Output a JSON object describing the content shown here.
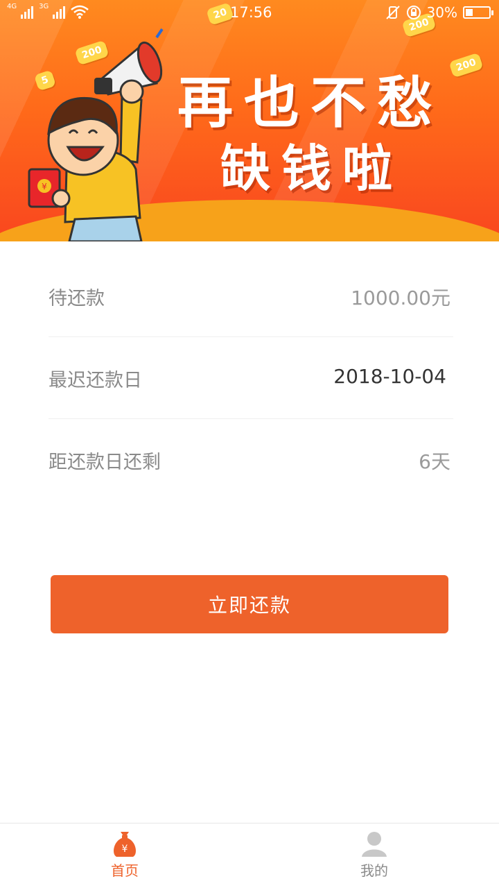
{
  "status_bar": {
    "network_1": "4G",
    "network_2": "3G",
    "time": "17:56",
    "battery_text": "30%",
    "battery_level": 0.3
  },
  "banner": {
    "title_line1": "再也不愁",
    "title_line2": "缺钱啦",
    "chips": [
      "200",
      "200",
      "200",
      "5",
      "20"
    ],
    "colors": {
      "top": "#ff8a1f",
      "bottom": "#f9461f"
    }
  },
  "repayment": {
    "rows": [
      {
        "label": "待还款",
        "value": "1000.00元"
      },
      {
        "label": "最迟还款日",
        "value": "2018-10-04"
      },
      {
        "label": "距还款日还剩",
        "value": "6天"
      }
    ]
  },
  "action": {
    "repay_label": "立即还款",
    "accent": "#ee622b"
  },
  "tabbar": {
    "home_label": "首页",
    "home_icon": "money-bag-icon",
    "mine_label": "我的",
    "mine_icon": "user-icon"
  }
}
